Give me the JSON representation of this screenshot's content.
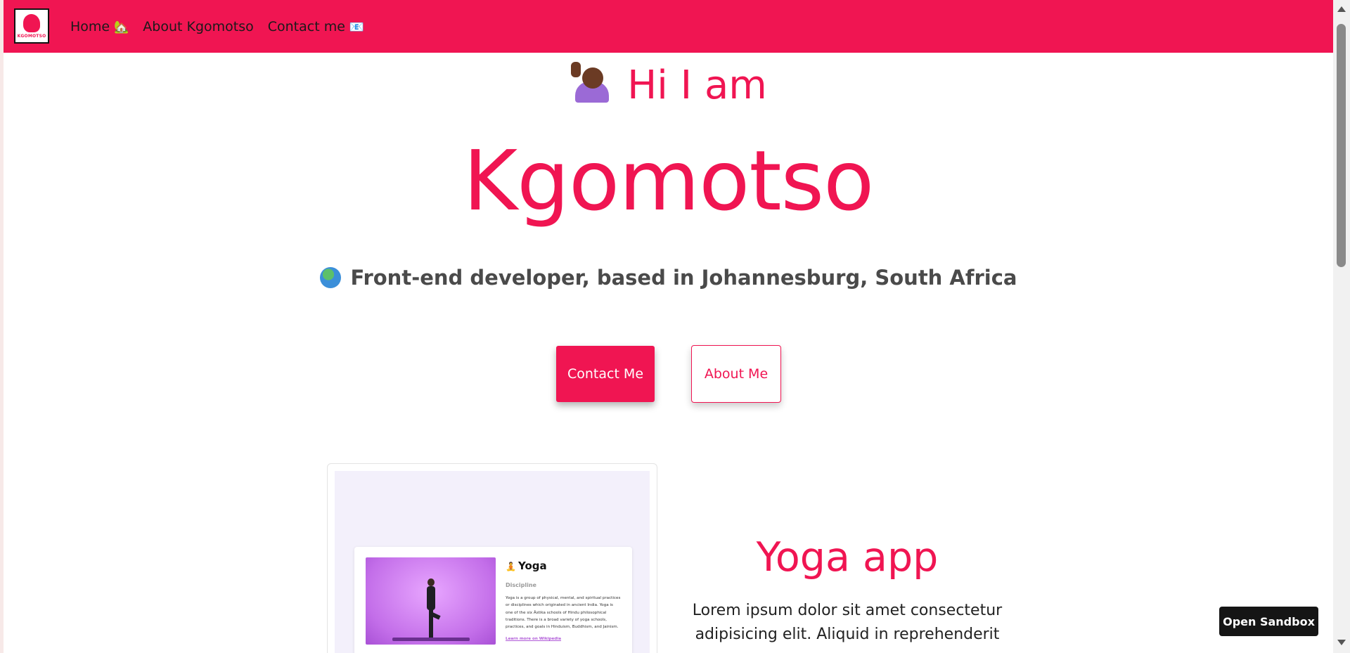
{
  "nav": {
    "logo_text": "KGOMOTSO",
    "links": [
      {
        "label": "Home",
        "icon": "🏡"
      },
      {
        "label": "About Kgomotso",
        "icon": ""
      },
      {
        "label": "Contact me",
        "icon": "📧"
      }
    ]
  },
  "hero": {
    "greeting": "Hi I am",
    "name": "Kgomotso",
    "tagline": "Front-end developer, based in Johannesburg, South Africa",
    "contact_button": "Contact Me",
    "about_button": "About Me"
  },
  "project": {
    "title": "Yoga app",
    "description": "Lorem ipsum dolor sit amet consectetur adipisicing elit. Aliquid in reprehenderit",
    "preview": {
      "title": "Yoga",
      "label": "Discipline",
      "description": "Yoga is a group of physical, mental, and spiritual practices or disciplines which originated in ancient India. Yoga is one of the six Āstika schools of Hindu philosophical traditions. There is a broad variety of yoga schools, practices, and goals in Hinduism, Buddhism, and Jainism.",
      "link": "Learn more on Wikipedia"
    }
  },
  "sandbox_button": "Open Sandbox",
  "colors": {
    "accent": "#f01552",
    "text": "#222222",
    "muted": "#4a4a4a"
  }
}
